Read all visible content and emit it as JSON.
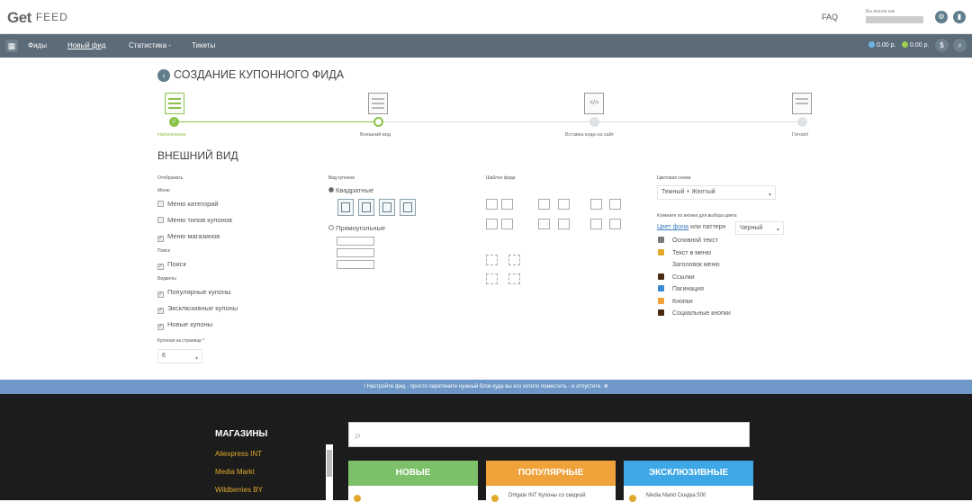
{
  "header": {
    "logo": "Get",
    "logo_sub": "FEED",
    "faq": "FAQ",
    "user_label": "Вы вошли как"
  },
  "nav": {
    "items": [
      "Фиды",
      "Новый фид",
      "Статистика -",
      "Тикеты"
    ],
    "balance1": "0.00 р.",
    "balance2": "0.00 р.",
    "icons": [
      "grid-icon",
      "settings-icon",
      "trash-icon",
      "dollar-icon",
      "search-icon"
    ]
  },
  "page": {
    "title": "СОЗДАНИЕ КУПОННОГО ФИДА",
    "steps": [
      {
        "label": "Наполнение",
        "state": "done"
      },
      {
        "label": "Внешний вид",
        "state": "current"
      },
      {
        "label": "Вставка кода на сайт",
        "state": "todo"
      },
      {
        "label": "Готово!",
        "state": "todo"
      }
    ],
    "section_title": "ВНЕШНИЙ ВИД"
  },
  "display": {
    "heading": "Отображать",
    "menu_label": "Меню",
    "menu_items": [
      "Меню категорий",
      "Меню типов купонов",
      "Меню магазинов"
    ],
    "search_label": "Поиск",
    "search_item": "Поиск",
    "widgets_label": "Виджеты",
    "widget_items": [
      "Популярные купоны",
      "Эксклюзивные купоны",
      "Новые купоны"
    ],
    "per_page_label": "Купонов на странице *",
    "per_page_value": "6"
  },
  "coupon_view": {
    "heading": "Вид купонов",
    "square": "Квадратные",
    "rect": "Прямоугольные"
  },
  "template": {
    "heading": "Шаблон фида"
  },
  "color": {
    "heading": "Цветовая схема",
    "scheme": "Темный + Желтый",
    "hint": "Кликните по иконке для выбора цвета",
    "bg_link": "Цвет фона",
    "or_pattern": "или паттерн",
    "pattern": "Черный",
    "items": [
      {
        "label": "Основной текст",
        "color": "#7a7a7a"
      },
      {
        "label": "Текст в меню",
        "color": "#e1a92b"
      },
      {
        "label": "Заголовок меню",
        "color": "#ffffff"
      },
      {
        "label": "Ссылки",
        "color": "#4a2a12"
      },
      {
        "label": "Пагинация",
        "color": "#3a8ad6"
      },
      {
        "label": "Кнопки",
        "color": "#f0a23a"
      },
      {
        "label": "Социальные кнопки",
        "color": "#4a2a12"
      }
    ]
  },
  "info": {
    "text": "Настройте фид - просто перетяните нужный блок куда вы его хотите поместить - и отпустите."
  },
  "preview": {
    "shops_title": "МАГАЗИНЫ",
    "shops": [
      "Aliexpress INT",
      "Media Markt",
      "Wildberries BY"
    ],
    "tabs": [
      {
        "label": "НОВЫЕ",
        "color": "#7cc16a"
      },
      {
        "label": "ПОПУЛЯРНЫЕ",
        "color": "#f0a23a"
      },
      {
        "label": "ЭКСКЛЮЗИВНЫЕ",
        "color": "#3ea8e6"
      }
    ],
    "previews": [
      "",
      "DHgate INT Купоны со скидкой",
      "Media Markt Скидка 500"
    ]
  }
}
